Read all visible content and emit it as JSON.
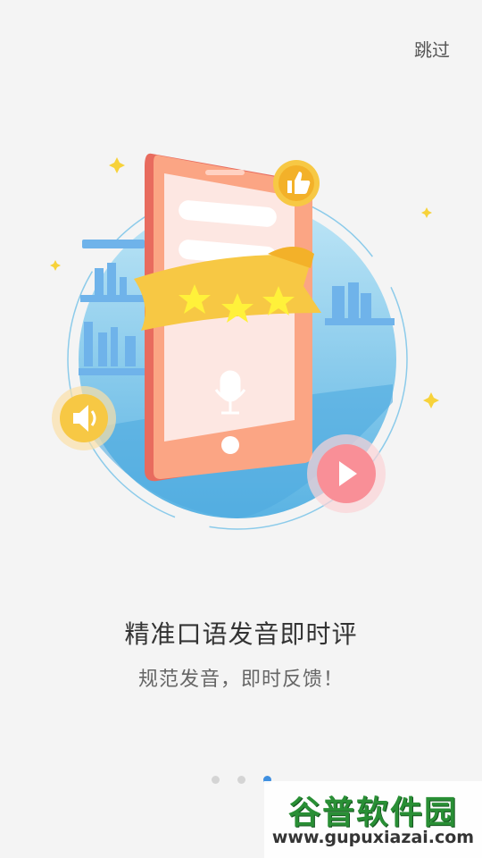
{
  "header": {
    "skip_label": "跳过"
  },
  "onboarding": {
    "title": "精准口语发音即时评",
    "subtitle": "规范发音，即时反馈！",
    "pages": 3,
    "active_index": 2
  },
  "watermark": {
    "title": "谷普软件园",
    "url": "www.gupuxiazai.com"
  },
  "colors": {
    "background": "#f4f4f4",
    "accent": "#3f8fe0",
    "phone": "#f78f7a",
    "ribbon": "#f7c844"
  }
}
